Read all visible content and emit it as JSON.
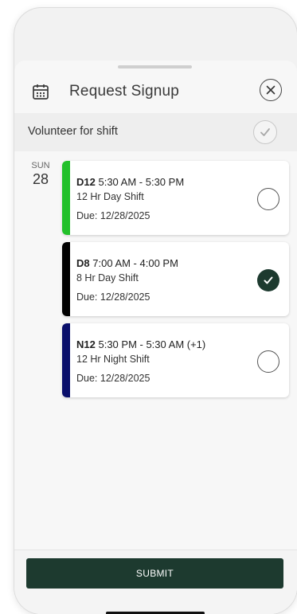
{
  "header": {
    "title": "Request Signup"
  },
  "volunteer": {
    "label": "Volunteer for shift",
    "checked": true
  },
  "date": {
    "dow": "SUN",
    "day": "28"
  },
  "shifts": [
    {
      "code": "D12",
      "time": "5:30 AM - 5:30 PM",
      "name": "12 Hr Day Shift",
      "due": "Due:  12/28/2025",
      "color": "#22c02a",
      "selected": false
    },
    {
      "code": "D8",
      "time": "7:00 AM - 4:00 PM",
      "name": "8 Hr Day Shift",
      "due": "Due:  12/28/2025",
      "color": "#000000",
      "selected": true
    },
    {
      "code": "N12",
      "time": "5:30 PM - 5:30 AM (+1)",
      "name": "12 Hr Night Shift",
      "due": "Due:  12/28/2025",
      "color": "#0a0f6b",
      "selected": false
    }
  ],
  "footer": {
    "submit_label": "SUBMIT"
  },
  "colors": {
    "accent": "#1d3a2f",
    "background": "#f7f7f7"
  },
  "icons": {
    "header": "calendar-icon",
    "close": "close-icon",
    "check": "checkmark-icon"
  }
}
